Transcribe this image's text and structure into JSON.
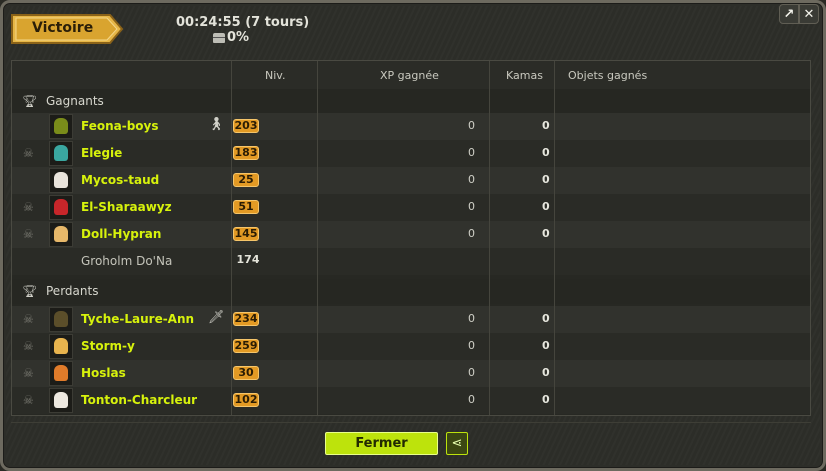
{
  "window": {
    "title": "Victoire",
    "detach_icon": "↗",
    "close_icon": "✕"
  },
  "fight": {
    "duration": "00:24:55 (7 tours)",
    "chest_percent": "0%"
  },
  "columns": {
    "level": "Niv.",
    "xp": "XP gagnée",
    "kamas": "Kamas",
    "items": "Objets gagnés"
  },
  "winners": {
    "label": "Gagnants",
    "rows": [
      {
        "name": "Feona-boys",
        "level": "203",
        "xp": "0",
        "kamas": "0",
        "avatar_color": "#7a8c1a",
        "dead": false,
        "icon": "person-icon"
      },
      {
        "name": "Elegie",
        "level": "183",
        "xp": "0",
        "kamas": "0",
        "avatar_color": "#3aa7a0",
        "dead": true
      },
      {
        "name": "Mycos-taud",
        "level": "25",
        "xp": "0",
        "kamas": "0",
        "avatar_color": "#e9e4dc",
        "dead": false
      },
      {
        "name": "El-Sharaawyz",
        "level": "51",
        "xp": "0",
        "kamas": "0",
        "avatar_color": "#c8262a",
        "dead": true
      },
      {
        "name": "Doll-Hypran",
        "level": "145",
        "xp": "0",
        "kamas": "0",
        "avatar_color": "#e7b86a",
        "dead": true
      }
    ],
    "npc": {
      "name": "Groholm Do'Na",
      "level": "174"
    }
  },
  "losers": {
    "label": "Perdants",
    "rows": [
      {
        "name": "Tyche-Laure-Ann",
        "level": "234",
        "xp": "0",
        "kamas": "0",
        "avatar_color": "#5b4e2a",
        "dead": true,
        "icon": "sword-icon"
      },
      {
        "name": "Storm-y",
        "level": "259",
        "xp": "0",
        "kamas": "0",
        "avatar_color": "#e8b44e",
        "dead": true
      },
      {
        "name": "Hoslas",
        "level": "30",
        "xp": "0",
        "kamas": "0",
        "avatar_color": "#e07b2a",
        "dead": true
      },
      {
        "name": "Tonton-Charcleur",
        "level": "102",
        "xp": "0",
        "kamas": "0",
        "avatar_color": "#ede8e0",
        "dead": true
      }
    ]
  },
  "footer": {
    "close_label": "Fermer",
    "share_icon": "share-icon"
  }
}
